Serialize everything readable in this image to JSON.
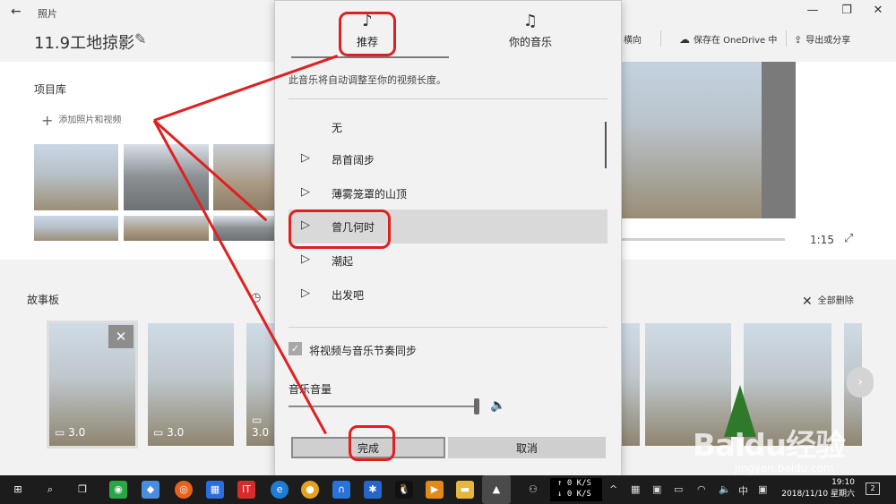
{
  "app": {
    "name": "照片",
    "project_title": "11.9工地掠影",
    "toolbar": {
      "landscape": "横向",
      "save_onedrive": "保存在 OneDrive 中",
      "export_share": "导出或分享"
    }
  },
  "library": {
    "title": "项目库",
    "add_label": "添加照片和视频"
  },
  "preview": {
    "duration": "1:15"
  },
  "storyboard": {
    "title": "故事板",
    "clear_all": "全部删除",
    "cards": [
      {
        "duration": "3.0"
      },
      {
        "duration": "3.0"
      },
      {
        "duration": "3.0"
      }
    ]
  },
  "music_dialog": {
    "tabs": [
      {
        "label": "推荐",
        "icon": "music-sparkle-icon"
      },
      {
        "label": "你的音乐",
        "icon": "person-music-icon"
      }
    ],
    "description": "此音乐将自动调整至你的视频长度。",
    "items": [
      {
        "label": "无",
        "has_play": false
      },
      {
        "label": "昂首阔步",
        "has_play": true
      },
      {
        "label": "薄雾笼罩的山顶",
        "has_play": true
      },
      {
        "label": "曾几何时",
        "has_play": true
      },
      {
        "label": "潮起",
        "has_play": true
      },
      {
        "label": "出发吧",
        "has_play": true
      }
    ],
    "selected_index": 3,
    "sync_label": "将视频与音乐节奏同步",
    "sync_checked": true,
    "volume_label": "音乐音量",
    "volume_level": 0.98,
    "done_label": "完成",
    "cancel_label": "取消"
  },
  "taskbar": {
    "net_up": "0 K/S",
    "net_down": "0 K/S",
    "ime": "中",
    "time": "19:10",
    "date": "2018/11/10 星期六",
    "notification_count": "2"
  },
  "watermark": {
    "text": "Baidu经验",
    "url": "jingyan.baidu.com"
  },
  "colors": {
    "annotation": "#e02020",
    "selected_row": "#d9d9d9",
    "taskbar": "#1c1c1c"
  }
}
